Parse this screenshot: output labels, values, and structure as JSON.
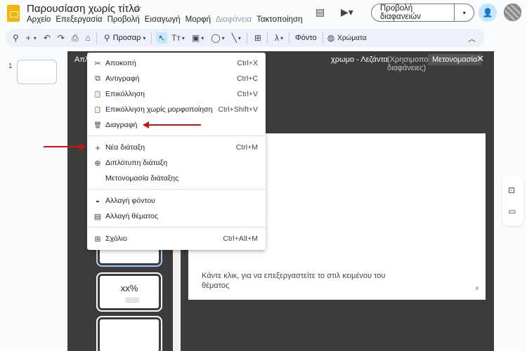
{
  "app": {
    "title": "Παρουσίαση χωρίς τίτλο"
  },
  "menubar": [
    "Αρχείο",
    "Επεξεργασία",
    "Προβολή",
    "Εισαγωγή",
    "Μορφή",
    "Διαφάνεια",
    "Τακτοποίηση"
  ],
  "header": {
    "slideshow_label": "Προβολή διαφανειών",
    "caret": "▾"
  },
  "toolbar": {
    "zoom_label": "Προσαρ",
    "text_icon": "Tт",
    "background_label": "Φόντο",
    "colors_label": "Χρώματα"
  },
  "filmstrip": {
    "slide_number": "1"
  },
  "layout_bar": {
    "label": "Απλ",
    "layout_name": "χρωμο - Λεζάντα",
    "used_text": "(Χρησιμοποιείται από 0 διαφάνειες)",
    "rename_label": "Μετονομασία"
  },
  "thumbs": {
    "percent_title": "xx%"
  },
  "slide": {
    "body_text": "Κάντε κλικ, για να επεξεργαστείτε το στιλ κειμένου του θέματος",
    "page_marker": "#"
  },
  "context_menu": {
    "items": [
      {
        "icon": "scissors-icon",
        "glyph": "✂",
        "label": "Αποκοπή",
        "shortcut": "Ctrl+X"
      },
      {
        "icon": "copy-icon",
        "glyph": "⧉",
        "label": "Αντιγραφή",
        "shortcut": "Ctrl+C"
      },
      {
        "icon": "paste-icon",
        "glyph": "📋",
        "label": "Επικόλληση",
        "shortcut": "Ctrl+V"
      },
      {
        "icon": "paste-plain-icon",
        "glyph": "📋",
        "label": "Επικόλληση χωρίς μορφοποίηση",
        "shortcut": "Ctrl+Shift+V"
      },
      {
        "icon": "trash-icon",
        "glyph": "🗑",
        "label": "Διαγραφή",
        "shortcut": ""
      },
      {
        "icon": "plus-icon",
        "glyph": "+",
        "label": "Νέα διάταξη",
        "shortcut": "Ctrl+M"
      },
      {
        "icon": "duplicate-icon",
        "glyph": "⊕",
        "label": "Διπλότυπη διάταξη",
        "shortcut": ""
      },
      {
        "icon": "",
        "glyph": "",
        "label": "Μετονομασία διάταξης",
        "shortcut": ""
      },
      {
        "icon": "fill-icon",
        "glyph": "◒",
        "label": "Αλλαγή φόντου",
        "shortcut": ""
      },
      {
        "icon": "theme-icon",
        "glyph": "▤",
        "label": "Αλλαγή θέματος",
        "shortcut": ""
      },
      {
        "icon": "comment-icon",
        "glyph": "⊞",
        "label": "Σχόλιο",
        "shortcut": "Ctrl+Alt+M"
      }
    ]
  },
  "annotations": {
    "arrow_color": "#d01010"
  }
}
